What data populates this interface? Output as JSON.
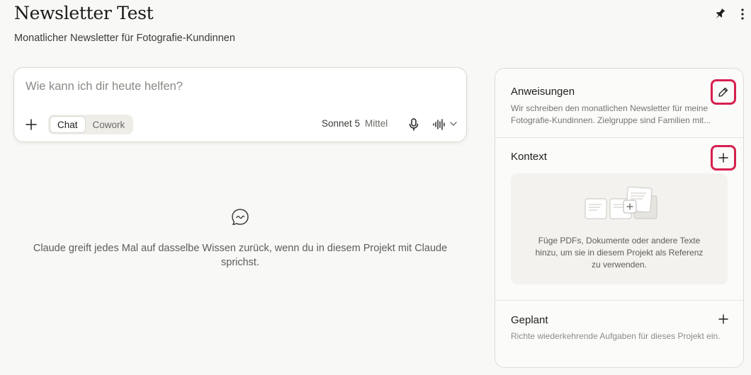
{
  "header": {
    "title": "Newsletter Test",
    "subtitle": "Monatlicher Newsletter für Fotografie-Kundinnen"
  },
  "composer": {
    "placeholder": "Wie kann ich dir heute helfen?",
    "modes": [
      "Chat",
      "Cowork"
    ],
    "active_mode": "Chat",
    "model": "Sonnet 5",
    "effort": "Mittel"
  },
  "empty_state": {
    "text": "Claude greift jedes Mal auf dasselbe Wissen zurück, wenn du in diesem Projekt mit Claude sprichst."
  },
  "panel": {
    "instructions": {
      "title": "Anweisungen",
      "text": "Wir schreiben den monatlichen Newsletter für meine Fotografie-Kundinnen. Zielgruppe sind Familien mit..."
    },
    "context": {
      "title": "Kontext",
      "drop_text": "Füge PDFs, Dokumente oder andere Texte hinzu, um sie in diesem Projekt als Referenz zu verwenden."
    },
    "planned": {
      "title": "Geplant",
      "text": "Richte wiederkehrende Aufgaben für dieses Projekt ein."
    }
  },
  "colors": {
    "highlight": "#d6204e",
    "background": "#f8f8f6"
  },
  "icons": [
    "pin-icon",
    "more-icon",
    "plus-icon",
    "mic-icon",
    "voice-icon",
    "chevron-down-icon",
    "chat-bubble-icon",
    "pencil-icon",
    "documents-illustration"
  ]
}
